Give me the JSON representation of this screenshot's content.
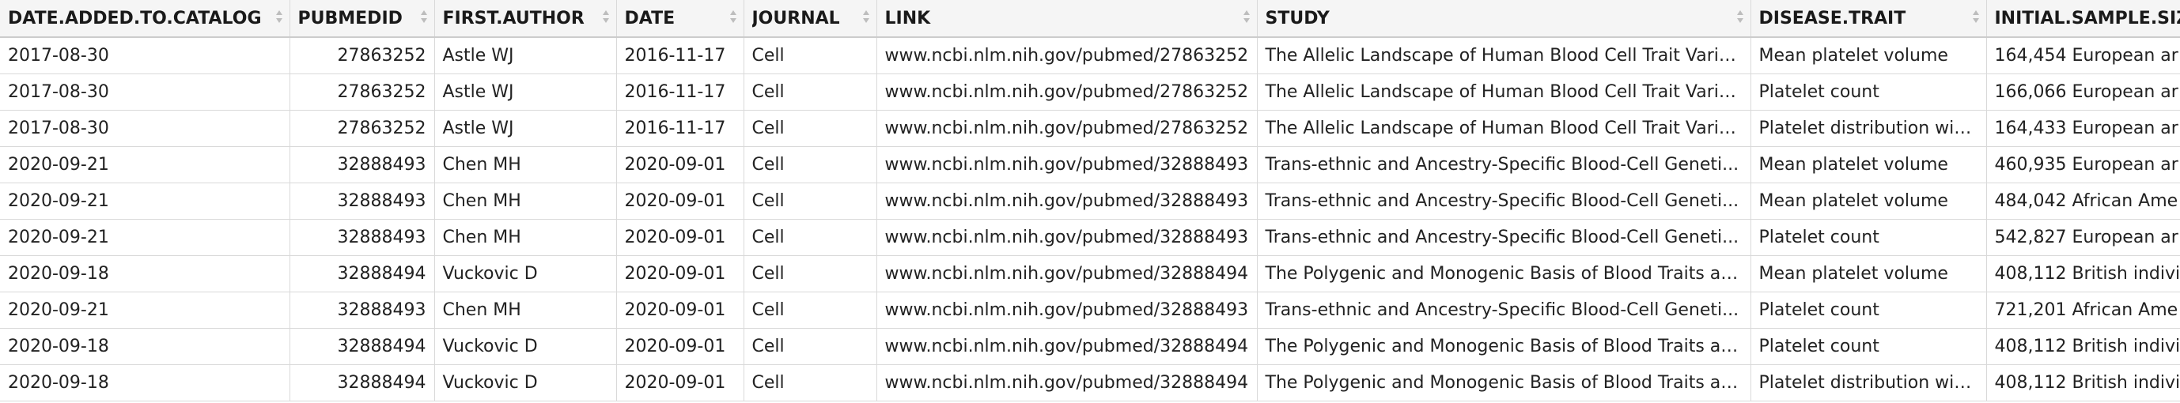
{
  "table": {
    "columns": [
      {
        "key": "date_added",
        "label": "DATE.ADDED.TO.CATALOG"
      },
      {
        "key": "pubmedid",
        "label": "PUBMEDID"
      },
      {
        "key": "first_author",
        "label": "FIRST.AUTHOR"
      },
      {
        "key": "date",
        "label": "DATE"
      },
      {
        "key": "journal",
        "label": "JOURNAL"
      },
      {
        "key": "link",
        "label": "LINK"
      },
      {
        "key": "study",
        "label": "STUDY"
      },
      {
        "key": "disease_trait",
        "label": "DISEASE.TRAIT"
      },
      {
        "key": "initial_sample_size",
        "label": "INITIAL.SAMPLE.SIZE"
      }
    ],
    "rows": [
      {
        "date_added": "2017-08-30",
        "pubmedid": "27863252",
        "first_author": "Astle WJ",
        "date": "2016-11-17",
        "journal": "Cell",
        "link": "www.ncbi.nlm.nih.gov/pubmed/27863252",
        "study": "The Allelic Landscape of Human Blood Cell Trait Varia...",
        "disease_trait": "Mean platelet volume",
        "initial_sample_size": "164,454 European ar"
      },
      {
        "date_added": "2017-08-30",
        "pubmedid": "27863252",
        "first_author": "Astle WJ",
        "date": "2016-11-17",
        "journal": "Cell",
        "link": "www.ncbi.nlm.nih.gov/pubmed/27863252",
        "study": "The Allelic Landscape of Human Blood Cell Trait Varia...",
        "disease_trait": "Platelet count",
        "initial_sample_size": "166,066 European ar"
      },
      {
        "date_added": "2017-08-30",
        "pubmedid": "27863252",
        "first_author": "Astle WJ",
        "date": "2016-11-17",
        "journal": "Cell",
        "link": "www.ncbi.nlm.nih.gov/pubmed/27863252",
        "study": "The Allelic Landscape of Human Blood Cell Trait Varia...",
        "disease_trait": "Platelet distribution width",
        "initial_sample_size": "164,433 European ar"
      },
      {
        "date_added": "2020-09-21",
        "pubmedid": "32888493",
        "first_author": "Chen MH",
        "date": "2020-09-01",
        "journal": "Cell",
        "link": "www.ncbi.nlm.nih.gov/pubmed/32888493",
        "study": "Trans-ethnic and Ancestry-Specific Blood-Cell Geneti...",
        "disease_trait": "Mean platelet volume",
        "initial_sample_size": "460,935 European ar"
      },
      {
        "date_added": "2020-09-21",
        "pubmedid": "32888493",
        "first_author": "Chen MH",
        "date": "2020-09-01",
        "journal": "Cell",
        "link": "www.ncbi.nlm.nih.gov/pubmed/32888493",
        "study": "Trans-ethnic and Ancestry-Specific Blood-Cell Geneti...",
        "disease_trait": "Mean platelet volume",
        "initial_sample_size": "484,042 African Ame"
      },
      {
        "date_added": "2020-09-21",
        "pubmedid": "32888493",
        "first_author": "Chen MH",
        "date": "2020-09-01",
        "journal": "Cell",
        "link": "www.ncbi.nlm.nih.gov/pubmed/32888493",
        "study": "Trans-ethnic and Ancestry-Specific Blood-Cell Geneti...",
        "disease_trait": "Platelet count",
        "initial_sample_size": "542,827 European ar"
      },
      {
        "date_added": "2020-09-18",
        "pubmedid": "32888494",
        "first_author": "Vuckovic D",
        "date": "2020-09-01",
        "journal": "Cell",
        "link": "www.ncbi.nlm.nih.gov/pubmed/32888494",
        "study": "The Polygenic and Monogenic Basis of Blood Traits an...",
        "disease_trait": "Mean platelet volume",
        "initial_sample_size": "408,112 British indivi"
      },
      {
        "date_added": "2020-09-21",
        "pubmedid": "32888493",
        "first_author": "Chen MH",
        "date": "2020-09-01",
        "journal": "Cell",
        "link": "www.ncbi.nlm.nih.gov/pubmed/32888493",
        "study": "Trans-ethnic and Ancestry-Specific Blood-Cell Geneti...",
        "disease_trait": "Platelet count",
        "initial_sample_size": "721,201 African Ame"
      },
      {
        "date_added": "2020-09-18",
        "pubmedid": "32888494",
        "first_author": "Vuckovic D",
        "date": "2020-09-01",
        "journal": "Cell",
        "link": "www.ncbi.nlm.nih.gov/pubmed/32888494",
        "study": "The Polygenic and Monogenic Basis of Blood Traits an...",
        "disease_trait": "Platelet count",
        "initial_sample_size": "408,112 British indivi"
      },
      {
        "date_added": "2020-09-18",
        "pubmedid": "32888494",
        "first_author": "Vuckovic D",
        "date": "2020-09-01",
        "journal": "Cell",
        "link": "www.ncbi.nlm.nih.gov/pubmed/32888494",
        "study": "The Polygenic and Monogenic Basis of Blood Traits an...",
        "disease_trait": "Platelet distribution width",
        "initial_sample_size": "408,112 British indivi"
      }
    ]
  },
  "icons": {
    "sort": "sort-arrows-icon"
  },
  "colors": {
    "header_bg": "#f5f5f5",
    "grid_line": "#d9d9d9",
    "text": "#222222"
  }
}
